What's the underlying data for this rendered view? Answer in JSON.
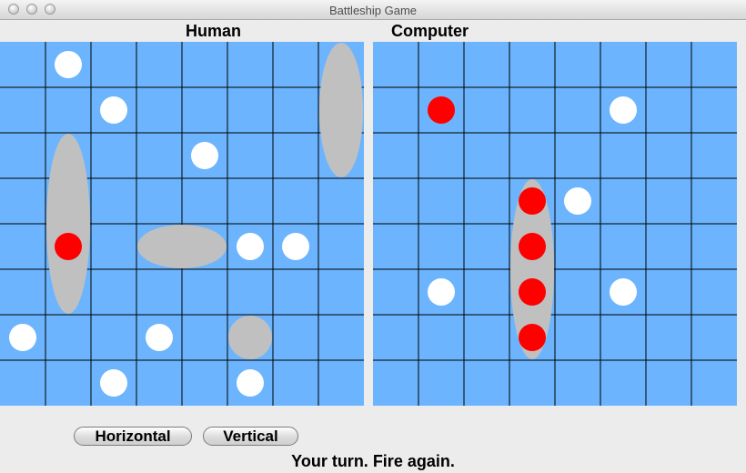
{
  "window": {
    "title": "Battleship Game"
  },
  "boards": [
    {
      "id": "human",
      "label": "Human",
      "ships": [
        {
          "col": 1,
          "row": 2,
          "length": 4,
          "orientation": "vertical"
        },
        {
          "col": 7,
          "row": 0,
          "length": 3,
          "orientation": "vertical"
        },
        {
          "col": 3,
          "row": 4,
          "length": 2,
          "orientation": "horizontal"
        },
        {
          "col": 5,
          "row": 6,
          "length": 1,
          "orientation": "horizontal"
        }
      ],
      "hits": [
        [
          1,
          4
        ]
      ],
      "misses": [
        [
          1,
          0
        ],
        [
          2,
          1
        ],
        [
          4,
          2
        ],
        [
          5,
          4
        ],
        [
          6,
          4
        ],
        [
          0,
          6
        ],
        [
          3,
          6
        ],
        [
          2,
          7
        ],
        [
          5,
          7
        ]
      ]
    },
    {
      "id": "computer",
      "label": "Computer",
      "ships": [
        {
          "col": 3,
          "row": 3,
          "length": 4,
          "orientation": "vertical"
        }
      ],
      "hits": [
        [
          1,
          1
        ],
        [
          3,
          3
        ],
        [
          3,
          4
        ],
        [
          3,
          5
        ],
        [
          3,
          6
        ]
      ],
      "misses": [
        [
          5,
          1
        ],
        [
          4,
          3
        ],
        [
          1,
          5
        ],
        [
          5,
          5
        ]
      ]
    }
  ],
  "grid": {
    "cols": 8,
    "rows": 8
  },
  "colors": {
    "water": "#6cb4fd",
    "grid_line": "#000000",
    "ship": "#c0c0c0",
    "hit": "#ff0000",
    "miss": "#ffffff"
  },
  "controls": {
    "horizontal_label": "Horizontal",
    "vertical_label": "Vertical"
  },
  "status": {
    "message": "Your turn. Fire again."
  }
}
